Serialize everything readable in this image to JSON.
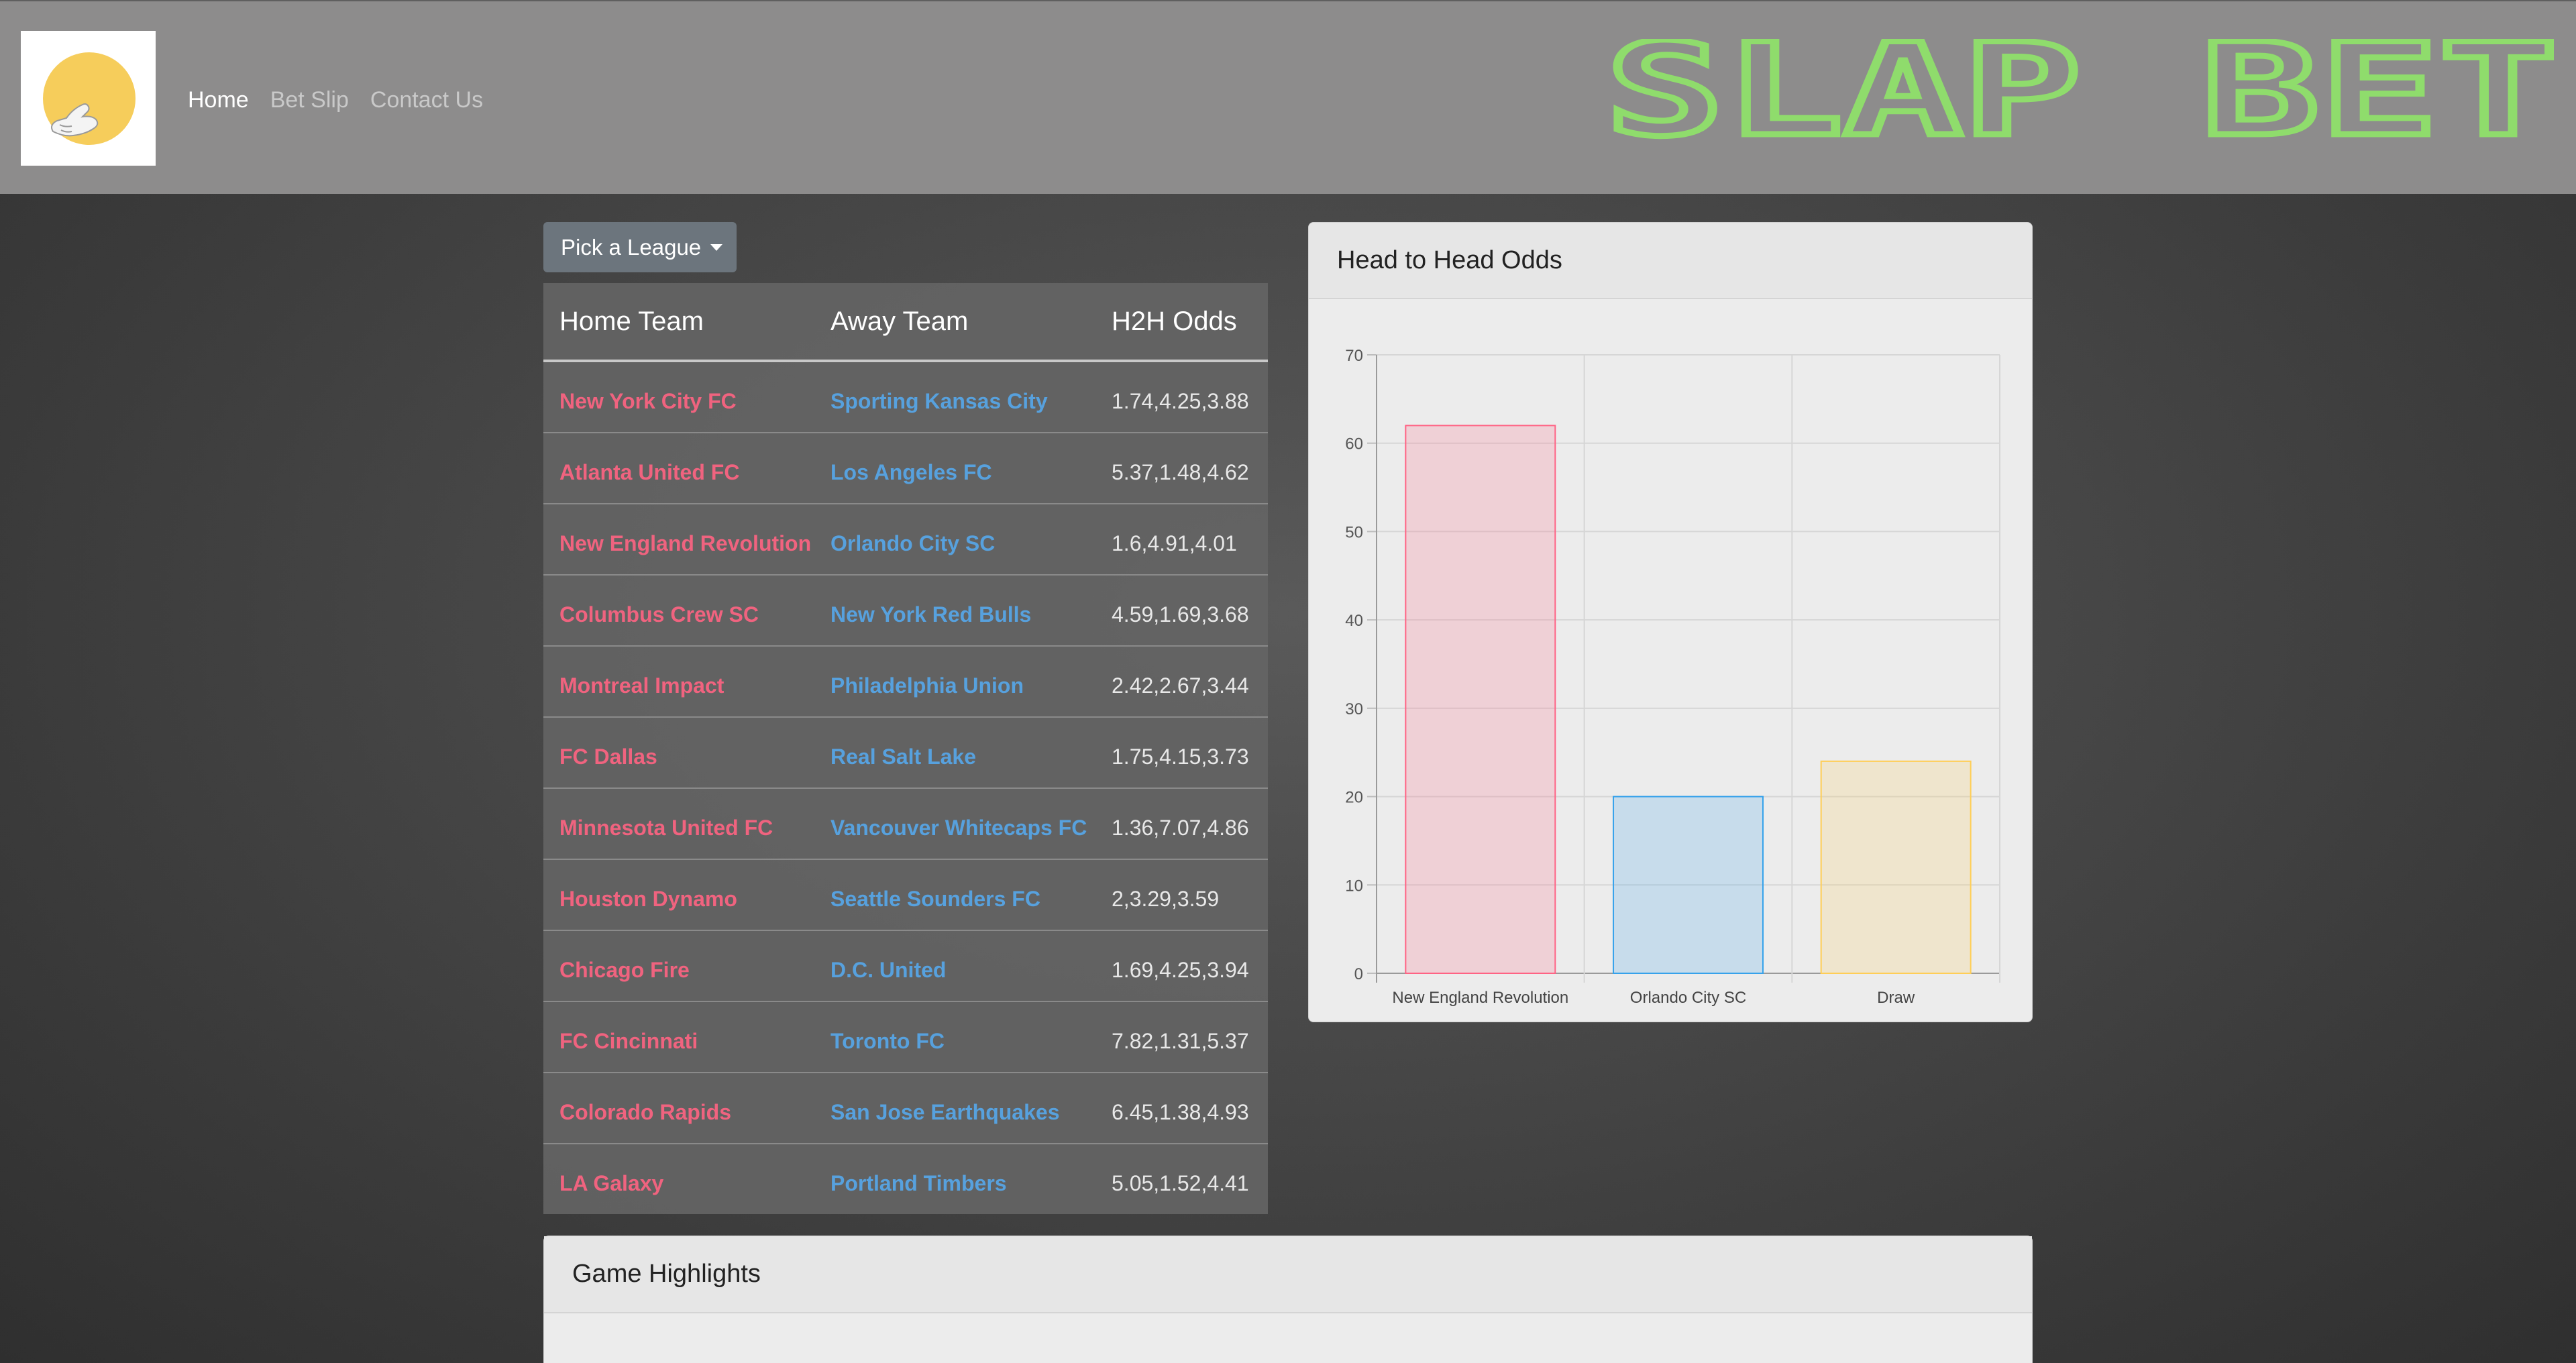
{
  "nav": {
    "logo_name": "slap-hand-logo",
    "links": [
      {
        "label": "Home",
        "active": true
      },
      {
        "label": "Bet Slip",
        "active": false
      },
      {
        "label": "Contact Us",
        "active": false
      }
    ],
    "brand": "SLAP BET",
    "brand_color": "#8fdc6c"
  },
  "league_dropdown": {
    "label": "Pick a League"
  },
  "table": {
    "headers": [
      "Home Team",
      "Away Team",
      "H2H Odds"
    ],
    "rows": [
      {
        "home": "New York City FC",
        "away": "Sporting Kansas City",
        "odds": "1.74,4.25,3.88"
      },
      {
        "home": "Atlanta United FC",
        "away": "Los Angeles FC",
        "odds": "5.37,1.48,4.62"
      },
      {
        "home": "New England Revolution",
        "away": "Orlando City SC",
        "odds": "1.6,4.91,4.01"
      },
      {
        "home": "Columbus Crew SC",
        "away": "New York Red Bulls",
        "odds": "4.59,1.69,3.68"
      },
      {
        "home": "Montreal Impact",
        "away": "Philadelphia Union",
        "odds": "2.42,2.67,3.44"
      },
      {
        "home": "FC Dallas",
        "away": "Real Salt Lake",
        "odds": "1.75,4.15,3.73"
      },
      {
        "home": "Minnesota United FC",
        "away": "Vancouver Whitecaps FC",
        "odds": "1.36,7.07,4.86"
      },
      {
        "home": "Houston Dynamo",
        "away": "Seattle Sounders FC",
        "odds": "2,3.29,3.59"
      },
      {
        "home": "Chicago Fire",
        "away": "D.C. United",
        "odds": "1.69,4.25,3.94"
      },
      {
        "home": "FC Cincinnati",
        "away": "Toronto FC",
        "odds": "7.82,1.31,5.37"
      },
      {
        "home": "Colorado Rapids",
        "away": "San Jose Earthquakes",
        "odds": "6.45,1.38,4.93"
      },
      {
        "home": "LA Galaxy",
        "away": "Portland Timbers",
        "odds": "5.05,1.52,4.41"
      }
    ],
    "colors": {
      "home": "#f0637f",
      "away": "#57a1de"
    }
  },
  "chart_card": {
    "title": "Head to Head Odds"
  },
  "chart_data": {
    "type": "bar",
    "categories": [
      "New England Revolution",
      "Orlando City SC",
      "Draw"
    ],
    "values": [
      62,
      20,
      24
    ],
    "ylim": [
      0,
      70
    ],
    "yticks": [
      0,
      10,
      20,
      30,
      40,
      50,
      60,
      70
    ],
    "grid": true,
    "colors": [
      {
        "fill": "rgba(255,99,132,0.2)",
        "stroke": "#ff6384"
      },
      {
        "fill": "rgba(54,162,235,0.2)",
        "stroke": "#36a2eb"
      },
      {
        "fill": "rgba(255,206,86,0.2)",
        "stroke": "#ffce56"
      }
    ]
  },
  "highlights_card": {
    "title": "Game Highlights"
  }
}
